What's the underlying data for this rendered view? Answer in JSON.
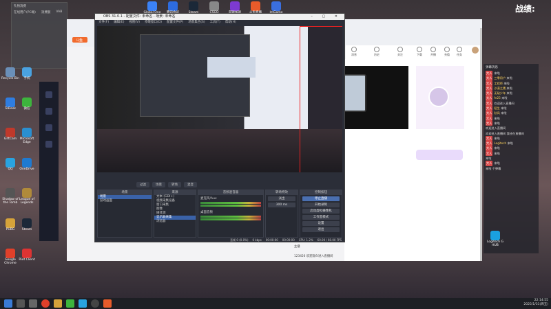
{
  "score_label": "战绩:",
  "widget": {
    "title": "礼物消费",
    "tabs": [
      "在线用户(PC端)",
      "消费额",
      "VAB"
    ],
    "lines": [
      "",
      "",
      ""
    ]
  },
  "desktop_icons": [
    {
      "label": "Recycle Bin",
      "color": "#6a8fb8"
    },
    {
      "label": "手机",
      "color": "#4aa2e0"
    },
    {
      "label": "ToDesk",
      "color": "#2f7de0"
    },
    {
      "label": "微信",
      "color": "#3db43d"
    },
    {
      "label": "GiftCam",
      "color": "#c0392b"
    },
    {
      "label": "Microsoft Edge",
      "color": "#2a8fd0"
    },
    {
      "label": "QQ",
      "color": "#29a3e0"
    },
    {
      "label": "OneDrive",
      "color": "#1f7ad0"
    },
    {
      "label": "Shadow of the Tomb",
      "color": "#555"
    },
    {
      "label": "League of Legends",
      "color": "#b08a3a"
    },
    {
      "label": "PUBG",
      "color": "#d6a33a"
    },
    {
      "label": "Steam",
      "color": "#1b2838"
    },
    {
      "label": "Google Chrome",
      "color": "#e0402a"
    },
    {
      "label": "Riot Client",
      "color": "#d33"
    }
  ],
  "top_icons": [
    {
      "label": "Global One",
      "color": "#3b82f6"
    },
    {
      "label": "腾讯会议",
      "color": "#2d6cdf"
    },
    {
      "label": "Steam",
      "color": "#1b2838"
    },
    {
      "label": "CSGO",
      "color": "#888"
    },
    {
      "label": "游戏加速",
      "color": "#7d3ad1"
    },
    {
      "label": "斗鱼直播",
      "color": "#e85b2a"
    },
    {
      "label": "ImGame",
      "color": "#3a6fe0"
    }
  ],
  "obs": {
    "title": "OBS 31.0.1 - 配置文件: 未命名 - 场景: 未命名",
    "menu": [
      "文件(F)",
      "编辑(E)",
      "视图(V)",
      "停靠窗口(D)",
      "配置文件(P)",
      "场景集合(S)",
      "工具(T)",
      "帮助(H)"
    ],
    "dock_tabs": [
      "过滤",
      "场景",
      "转场",
      "混音"
    ],
    "scenes_header": "场景",
    "scenes": [
      "场景",
      "游戏画面"
    ],
    "sources_header": "来源",
    "sources": [
      "文本 (GDI+)",
      "视频采集设备",
      "窗口采集",
      "图像",
      "媒体源",
      "显示器采集",
      "浏览器"
    ],
    "mixer_header": "音频混音器",
    "mixer": [
      {
        "name": "麦克风/Aux",
        "db": "0.0 dB"
      },
      {
        "name": "桌面音频",
        "db": "0.0 dB"
      }
    ],
    "transitions_header": "转场特效",
    "transition": "淡出",
    "duration": "300 ms",
    "controls_header": "控制按钮",
    "controls": [
      "停止直播",
      "开始录制",
      "启动虚拟摄像机",
      "工作室模式",
      "设置",
      "退出"
    ],
    "status": [
      "丢帧 0 (0.0%)",
      "0 kbps",
      "00:00:00",
      "00:00:00",
      "CPU: 1.2%",
      "60.00 / 60.00 FPS"
    ]
  },
  "browser": {
    "tab_label": "斗鱼",
    "nav_items": [
      "消息",
      "历史",
      "关注",
      "下载",
      "开播",
      "充值",
      "任务"
    ],
    "buttons": [
      "PC客户端"
    ],
    "chat": [
      {
        "user": "开播",
        "text": "送出了 1 个 弹幕卡"
      },
      {
        "user": "关注",
        "text": "2 个 鲜花"
      },
      {
        "user": "粉丝",
        "text": "弹幕"
      },
      {
        "user": "",
        "text": "主播: 铂先 我想了一直播中, 加把劲"
      },
      {
        "user": "",
        "text": "主播: 铂先 我想了一直播中"
      },
      {
        "user": "[主播]",
        "text": "铂达高速阿斯"
      },
      {
        "user": "",
        "text": "欢迎来到本直播间, 请文明发言"
      },
      {
        "user": "",
        "text": "本直播间为PC端观看, 请遵守直播规则"
      },
      {
        "user": "主播",
        "text": "为您献上"
      },
      {
        "user": "",
        "text": "粉丝团 门门门"
      },
      {
        "user": "",
        "text": "闪亮 13 级"
      },
      {
        "user": "",
        "text": "主播"
      },
      {
        "user": "",
        "text": "123456  欢迎观众进入直播间"
      }
    ]
  },
  "danmaku": {
    "header": "弹幕消息",
    "lines": [
      {
        "lv": "大人",
        "user": "",
        "text": "来啦"
      },
      {
        "lv": "大人",
        "user": "三零用户",
        "text": "来啦"
      },
      {
        "lv": "大人",
        "user": "工程师",
        "text": "来啦"
      },
      {
        "lv": "大人",
        "user": "沙漠之鹰",
        "text": "来啦"
      },
      {
        "lv": "大人",
        "user": "无敌少年",
        "text": "来啦"
      },
      {
        "lv": "大人",
        "user": "fe25",
        "text": "来啦"
      },
      {
        "lv": "大人",
        "user": "",
        "text": "欢迎进入直播间"
      },
      {
        "lv": "大人",
        "user": "陌生",
        "text": "来啦"
      },
      {
        "lv": "大人",
        "user": "秋风",
        "text": "来啦"
      },
      {
        "lv": "大人",
        "user": "",
        "text": "来啦"
      },
      {
        "lv": "大人",
        "user": "",
        "text": "来啦"
      },
      {
        "lv": "",
        "user": "",
        "text": "欢迎进入直播间"
      },
      {
        "lv": "",
        "user": "",
        "text": "欢迎进入直播间 我还在直播间"
      },
      {
        "lv": "大人",
        "user": "",
        "text": "来啦"
      },
      {
        "lv": "大人",
        "user": "Logitech",
        "text": "来啦"
      },
      {
        "lv": "大人",
        "user": "",
        "text": "来啦"
      },
      {
        "lv": "大人",
        "user": "",
        "text": "来啦"
      },
      {
        "lv": "",
        "user": "",
        "text": "来啦"
      },
      {
        "lv": "大人",
        "user": "",
        "text": "来啦"
      },
      {
        "lv": "",
        "user": "",
        "text": "来啦 个弹幕"
      }
    ]
  },
  "logitech_label": "Logitech G HUB",
  "clock": {
    "time": "22:14:55",
    "date": "2025/1/31(周五)"
  }
}
